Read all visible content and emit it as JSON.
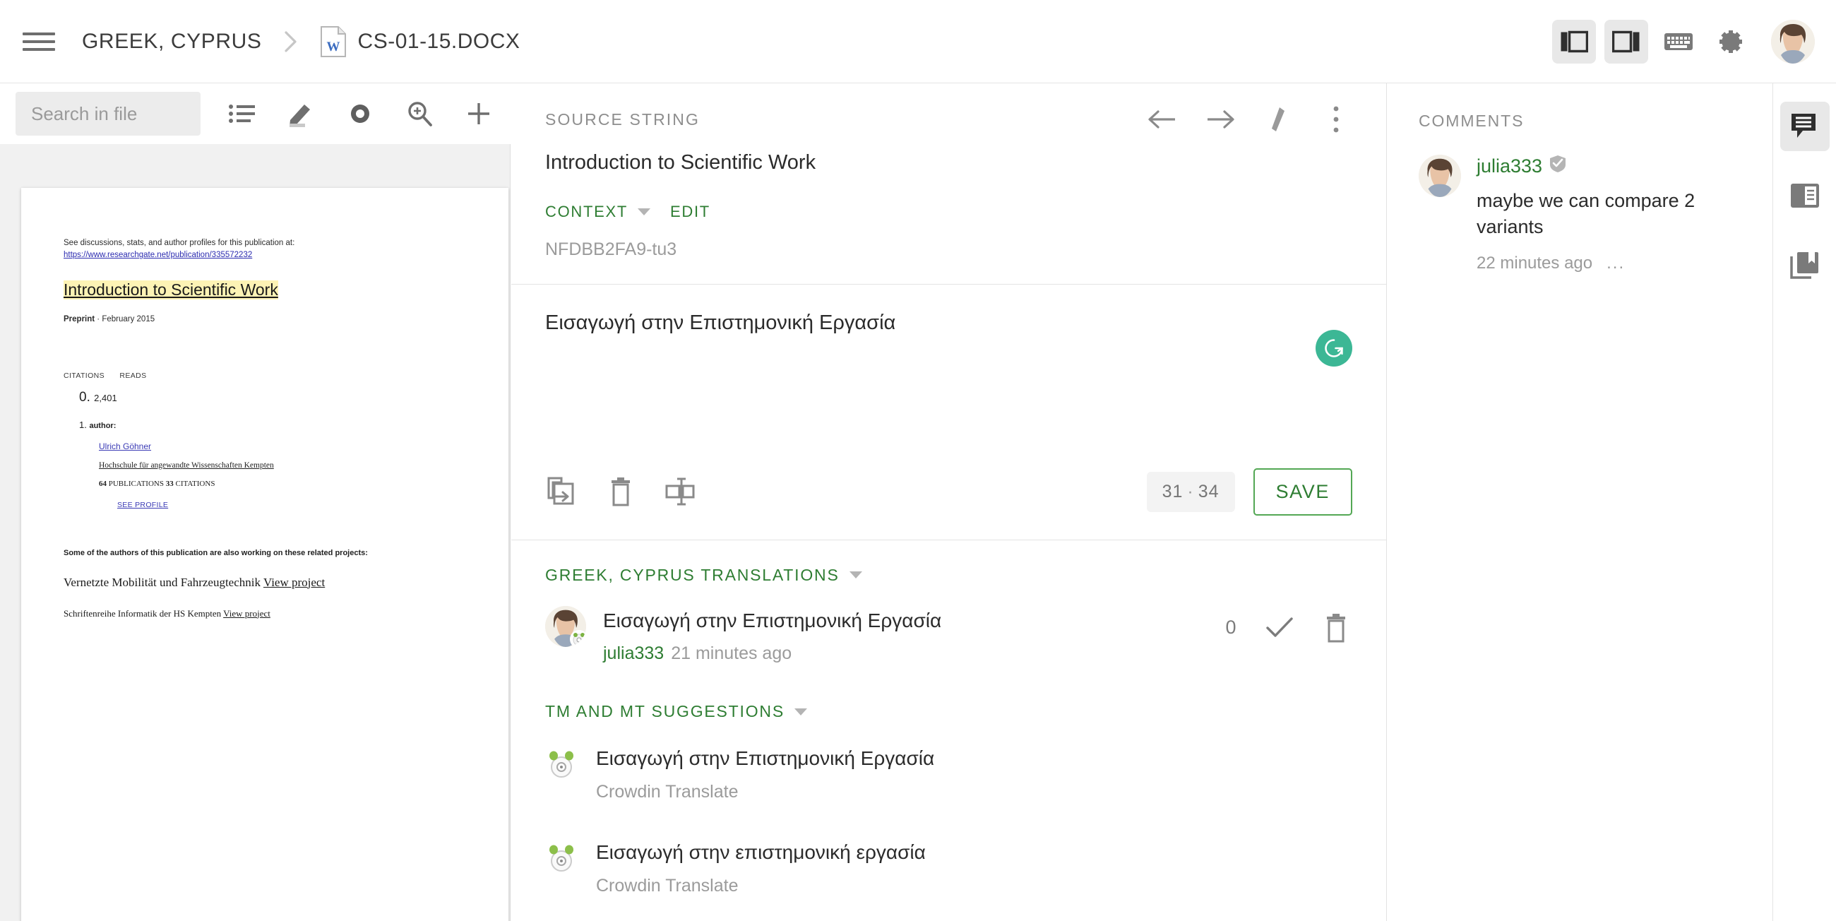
{
  "topbar": {
    "menu_icon": "hamburger-menu-icon",
    "project_name": "GREEK, CYPRUS",
    "separator": "›",
    "file_icon": "word-document-icon",
    "file_name": "CS-01-15.DOCX",
    "buttons": [
      {
        "name": "layout-left-toggle",
        "icon": "panel-left-icon",
        "active": true
      },
      {
        "name": "layout-right-toggle",
        "icon": "panel-right-icon",
        "active": true
      },
      {
        "name": "keyboard-shortcuts",
        "icon": "keyboard-icon",
        "active": false
      },
      {
        "name": "settings",
        "icon": "gear-icon",
        "active": false
      }
    ],
    "avatar": "user-avatar"
  },
  "left_panel": {
    "search": {
      "placeholder": "Search in file",
      "value": ""
    },
    "toolbar_icons": [
      {
        "name": "list-view-icon"
      },
      {
        "name": "edit-pencil-icon"
      },
      {
        "name": "preview-eye-icon"
      },
      {
        "name": "zoom-search-icon"
      },
      {
        "name": "add-plus-icon"
      }
    ],
    "document": {
      "intro_line": "See discussions, stats, and author profiles for this publication at:",
      "intro_link": "https://www.researchgate.net/publication/335572232",
      "title": "Introduction to Scientific Work",
      "preprint": "Preprint",
      "preprint_date": "· February 2015",
      "stat_labels": [
        "CITATIONS",
        "READS"
      ],
      "citations": "0",
      "reads": "2,401",
      "author_count": "1",
      "author_label": "author:",
      "author_name": "Ulrich Göhner",
      "author_affiliation": "Hochschule für angewandte Wissenschaften Kempten",
      "publications_count": "64",
      "publications_label": "PUBLICATIONS",
      "citations_count": "33",
      "citations_label": "CITATIONS",
      "see_profile": "SEE PROFILE",
      "related_note": "Some of the authors of this publication are also working on these related projects:",
      "project_1": "Vernetzte Mobilität und Fahrzeugtechnik",
      "project_1_link": "View project",
      "project_2": "Schriftenreihe Informatik der HS Kempten",
      "project_2_link": "View project"
    }
  },
  "center_panel": {
    "source": {
      "label": "SOURCE STRING",
      "text": "Introduction to Scientific Work",
      "context_label": "CONTEXT",
      "edit_label": "EDIT",
      "string_id": "NFDBB2FA9-tu3",
      "actions": [
        {
          "name": "previous-string-button",
          "icon": "arrow-left-icon"
        },
        {
          "name": "next-string-button",
          "icon": "arrow-right-icon"
        },
        {
          "name": "edit-source-button",
          "icon": "pencil-icon"
        },
        {
          "name": "more-options-button",
          "icon": "kebab-menu-icon"
        }
      ]
    },
    "editor": {
      "value": "Εισαγωγή στην Επιστημονική Εργασία",
      "grammarly_icon": "grammarly-icon",
      "grammarly_color": "#3cb795",
      "tools": [
        {
          "name": "copy-source-button",
          "icon": "copy-source-icon"
        },
        {
          "name": "clear-translation-button",
          "icon": "trash-icon"
        },
        {
          "name": "insert-tag-button",
          "icon": "insert-tag-icon"
        }
      ],
      "char_count": "31",
      "char_separator": "·",
      "char_limit": "34",
      "save_label": "SAVE",
      "save_color": "#2e7d32"
    },
    "translations_section": {
      "title": "GREEK, CYPRUS TRANSLATIONS",
      "items": [
        {
          "text": "Εισαγωγή στην Επιστημονική Εργασία",
          "user": "julia333",
          "time": "21 minutes ago",
          "votes": "0",
          "approve_icon": "check-icon",
          "delete_icon": "trash-icon"
        }
      ]
    },
    "suggestions_section": {
      "title": "TM AND MT SUGGESTIONS",
      "items": [
        {
          "text": "Εισαγωγή στην Επιστημονική Εργασία",
          "source": "Crowdin Translate",
          "icon": "crowdin-icon"
        },
        {
          "text": "Εισαγωγή στην επιστημονική εργασία",
          "source": "Crowdin Translate",
          "icon": "crowdin-icon"
        }
      ]
    }
  },
  "right_panel": {
    "title": "COMMENTS",
    "comments": [
      {
        "user": "julia333",
        "verified_icon": "verified-badge-icon",
        "text": "maybe we can compare 2 variants",
        "time": "22 minutes ago",
        "more": "..."
      }
    ],
    "rail": [
      {
        "name": "comments-tab",
        "icon": "comment-icon",
        "active": true
      },
      {
        "name": "terms-tab",
        "icon": "terms-icon",
        "active": false
      },
      {
        "name": "glossary-tab",
        "icon": "glossary-icon",
        "active": false
      }
    ]
  }
}
